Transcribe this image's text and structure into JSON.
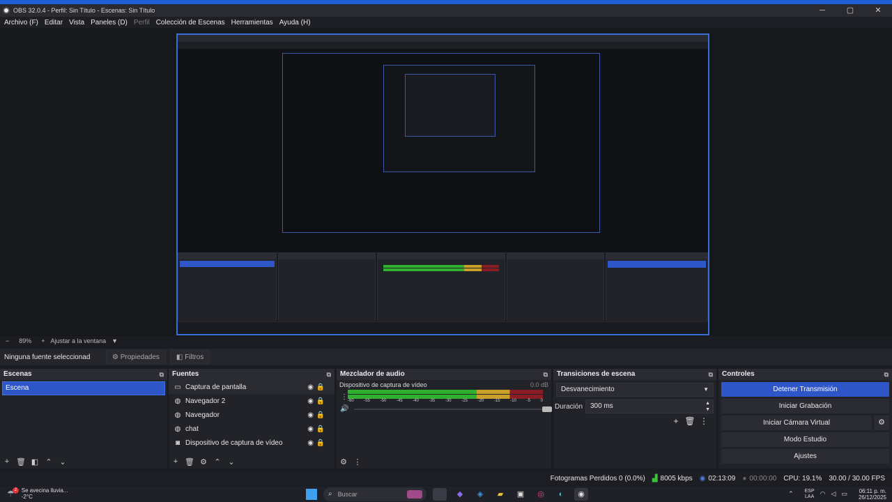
{
  "window": {
    "title": "OBS 32.0.4 - Perfil: Sin Título - Escenas: Sin Título",
    "min": "─",
    "max": "▢",
    "close": "✕"
  },
  "menu": {
    "archivo": "Archivo (F)",
    "editar": "Editar",
    "vista": "Vista",
    "paneles": "Paneles (D)",
    "perfil": "Perfil",
    "coleccion": "Colección de Escenas",
    "herramientas": "Herramientas",
    "ayuda": "Ayuda (H)"
  },
  "zoom": {
    "minus": "−",
    "value": "89%",
    "plus": "+",
    "fit": "Ajustar a la ventana",
    "arrow": "▼"
  },
  "properties_bar": {
    "no_source": "Ninguna fuente seleccionad",
    "properties": "Propiedades",
    "filters": "Filtros"
  },
  "scenes": {
    "header": "Escenas",
    "items": [
      "Escena"
    ]
  },
  "sources": {
    "header": "Fuentes",
    "items": [
      {
        "name": "Captura de pantalla",
        "icon": "monitor-icon"
      },
      {
        "name": "Navegador 2",
        "icon": "globe-icon"
      },
      {
        "name": "Navegador",
        "icon": "globe-icon"
      },
      {
        "name": "chat",
        "icon": "globe-icon"
      },
      {
        "name": "Dispositivo de captura de vídeo",
        "icon": "camera-icon"
      }
    ]
  },
  "mixer": {
    "header": "Mezclador de audio",
    "device": "Dispositivo de captura de vídeo",
    "db": "0.0 dB",
    "ticks": [
      "-60",
      "-55",
      "-50",
      "-45",
      "-40",
      "-35",
      "-30",
      "-25",
      "-20",
      "-15",
      "-10",
      "-5",
      "0"
    ],
    "volume_level": 1.0
  },
  "transitions": {
    "header": "Transiciones de escena",
    "selected": "Desvanecimiento",
    "duration_label": "Duración",
    "duration_value": "300 ms"
  },
  "controls": {
    "header": "Controles",
    "stop_stream": "Detener Transmisión",
    "start_recording": "Iniciar Grabación",
    "virtual_cam": "Iniciar Cámara Virtual",
    "studio_mode": "Modo Estudio",
    "settings": "Ajustes"
  },
  "status": {
    "dropped": "Fotogramas Perdidos 0 (0.0%)",
    "bitrate": "8005 kbps",
    "stream_time": "02:13:09",
    "rec_time": "00:00:00",
    "cpu": "CPU: 19.1%",
    "fps": "30.00 / 30.00 FPS"
  },
  "taskbar": {
    "weather_line1": "Se avecina lluvia...",
    "weather_line2": "-2°C",
    "badge": "2",
    "search_placeholder": "Buscar",
    "lang1": "ESP",
    "lang2": "LAA",
    "time": "06:11 p. m.",
    "date": "26/12/2025"
  },
  "colors": {
    "accent": "#2f56c8",
    "meter_green": "#2fb02f",
    "meter_yellow": "#c9a12a",
    "meter_red": "#8a1c24"
  }
}
